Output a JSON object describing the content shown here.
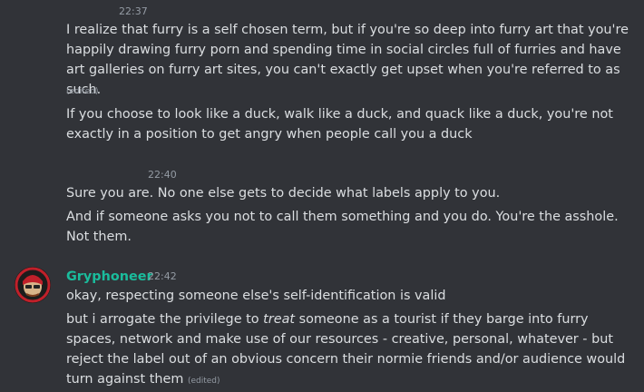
{
  "messages": {
    "m1": {
      "time": "22:37",
      "text": "I realize that furry is a self chosen term, but if you're so deep into furry art that you're happily drawing furry porn and spending time in social circles full of furries and have art galleries on furry art sites, you can't exactly get upset when you're referred to as such.",
      "edited": "(edited)"
    },
    "m2": {
      "text": "If you choose to look like a duck, walk like a duck, and quack like a duck, you're not exactly in a position to get angry when people call you a duck"
    },
    "m3": {
      "time": "22:40",
      "text": "Sure you are. No one else gets to decide what labels apply to you."
    },
    "m4": {
      "text": "And if someone asks you not to call them something and you do. You're the asshole. Not them."
    },
    "group": {
      "username": "Gryphoneer",
      "username_color": "#1abc9c",
      "time": "22:42",
      "m5": "okay, respecting someone else's self-identification is valid",
      "m6_pre": "but i arrogate the privilege to ",
      "m6_em": "treat",
      "m6_post": " someone as a tourist if they barge into furry spaces, network and make use of our resources - creative, personal, whatever - but reject the label out of an obvious concern their normie friends and/or audience would turn against them",
      "m6_edited": "(edited)"
    }
  }
}
